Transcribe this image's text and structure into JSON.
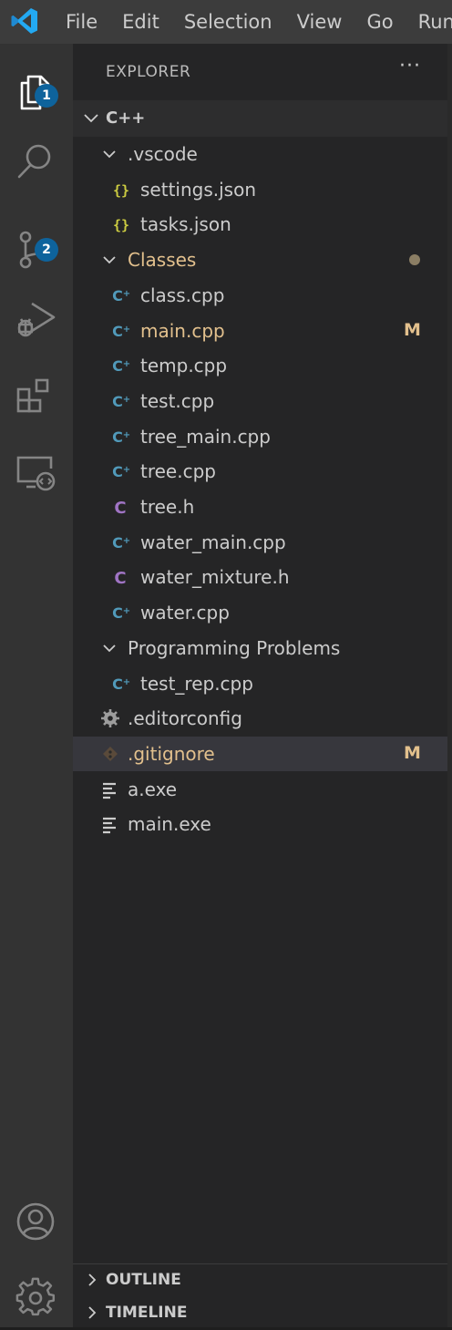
{
  "menu": [
    "File",
    "Edit",
    "Selection",
    "View",
    "Go",
    "Run"
  ],
  "activity_bar": {
    "explorer_badge": "1",
    "source_control_badge": "2",
    "items": [
      "explorer-icon",
      "search-icon",
      "source-control-icon",
      "run-debug-icon",
      "extensions-icon",
      "remote-explorer-icon",
      "account-icon",
      "settings-gear-icon"
    ]
  },
  "sidebar": {
    "title": "EXPLORER",
    "more_actions": "···",
    "root_folder": "C++",
    "tree": [
      {
        "label": ".vscode",
        "kind": "folder",
        "indent": 1
      },
      {
        "label": "settings.json",
        "kind": "json",
        "indent": 2
      },
      {
        "label": "tasks.json",
        "kind": "json",
        "indent": 2
      },
      {
        "label": "Classes",
        "kind": "folder",
        "indent": 1,
        "modified": true
      },
      {
        "label": "class.cpp",
        "kind": "cpp",
        "indent": 2
      },
      {
        "label": "main.cpp",
        "kind": "cpp",
        "indent": 2,
        "modified": true,
        "status": "M"
      },
      {
        "label": "temp.cpp",
        "kind": "cpp",
        "indent": 2
      },
      {
        "label": "test.cpp",
        "kind": "cpp",
        "indent": 2
      },
      {
        "label": "tree_main.cpp",
        "kind": "cpp",
        "indent": 2
      },
      {
        "label": "tree.cpp",
        "kind": "cpp",
        "indent": 2
      },
      {
        "label": "tree.h",
        "kind": "h",
        "indent": 2
      },
      {
        "label": "water_main.cpp",
        "kind": "cpp",
        "indent": 2
      },
      {
        "label": "water_mixture.h",
        "kind": "h",
        "indent": 2
      },
      {
        "label": "water.cpp",
        "kind": "cpp",
        "indent": 2
      },
      {
        "label": "Programming Problems",
        "kind": "folder",
        "indent": 1
      },
      {
        "label": "test_rep.cpp",
        "kind": "cpp",
        "indent": 2
      },
      {
        "label": ".editorconfig",
        "kind": "gear",
        "indent": 1
      },
      {
        "label": ".gitignore",
        "kind": "git",
        "indent": 1,
        "modified": true,
        "status": "M",
        "selected": true
      },
      {
        "label": "a.exe",
        "kind": "text",
        "indent": 1
      },
      {
        "label": "main.exe",
        "kind": "text",
        "indent": 1
      }
    ],
    "panels": [
      "OUTLINE",
      "TIMELINE"
    ]
  },
  "colors": {
    "cpp_icon": "#519aba",
    "h_icon": "#a074c4",
    "json_icon": "#cbcb41",
    "modified": "#e2c08d",
    "badge": "#0e639c"
  }
}
